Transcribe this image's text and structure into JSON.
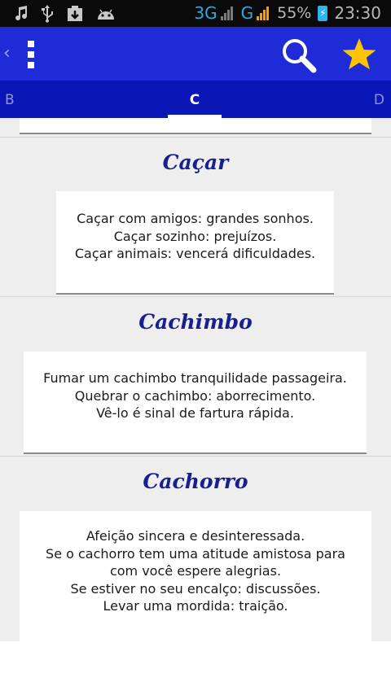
{
  "status_bar": {
    "left_icons": [
      "music-icon",
      "usb-icon",
      "download-icon",
      "android-icon"
    ],
    "network_1": "3G",
    "network_2": "G",
    "battery_percent": "55%",
    "time": "23:30",
    "colors": {
      "background": "#0a0a0a",
      "network": "#32a8e0",
      "signal_active": "#ff9c00",
      "battery": "#2eb3f0"
    }
  },
  "app_bar": {
    "back_glyph": "‹",
    "icons": [
      "back-icon",
      "overflow-menu-icon",
      "search-icon",
      "star-icon"
    ],
    "colors": {
      "background": "#1f2bd6",
      "star": "#ffc400"
    }
  },
  "tabs": {
    "prev": "B",
    "active": "C",
    "next": "D",
    "colors": {
      "background": "#0a16b5",
      "active": "#ffffff",
      "inactive": "#8f95d8"
    }
  },
  "entries": [
    {
      "title": "Caçar",
      "lines": [
        "Caçar com amigos: grandes sonhos.",
        "Caçar sozinho: prejuízos.",
        "Caçar animais: vencerá dificuldades."
      ]
    },
    {
      "title": "Cachimbo",
      "lines": [
        "Fumar um cachimbo tranquilidade passageira.",
        "Quebrar o cachimbo: aborrecimento.",
        "Vê-lo é sinal de fartura rápida."
      ]
    },
    {
      "title": "Cachorro",
      "lines": [
        "Afeição sincera e desinteressada.",
        "Se o cachorro tem uma atitude amistosa para",
        "com você espere alegrias.",
        "Se estiver no seu encalço: discussões.",
        "Levar uma mordida: traição."
      ]
    }
  ],
  "theme": {
    "title_color": "#18208f",
    "content_background": "#eeeeee",
    "card_background": "#ffffff"
  }
}
